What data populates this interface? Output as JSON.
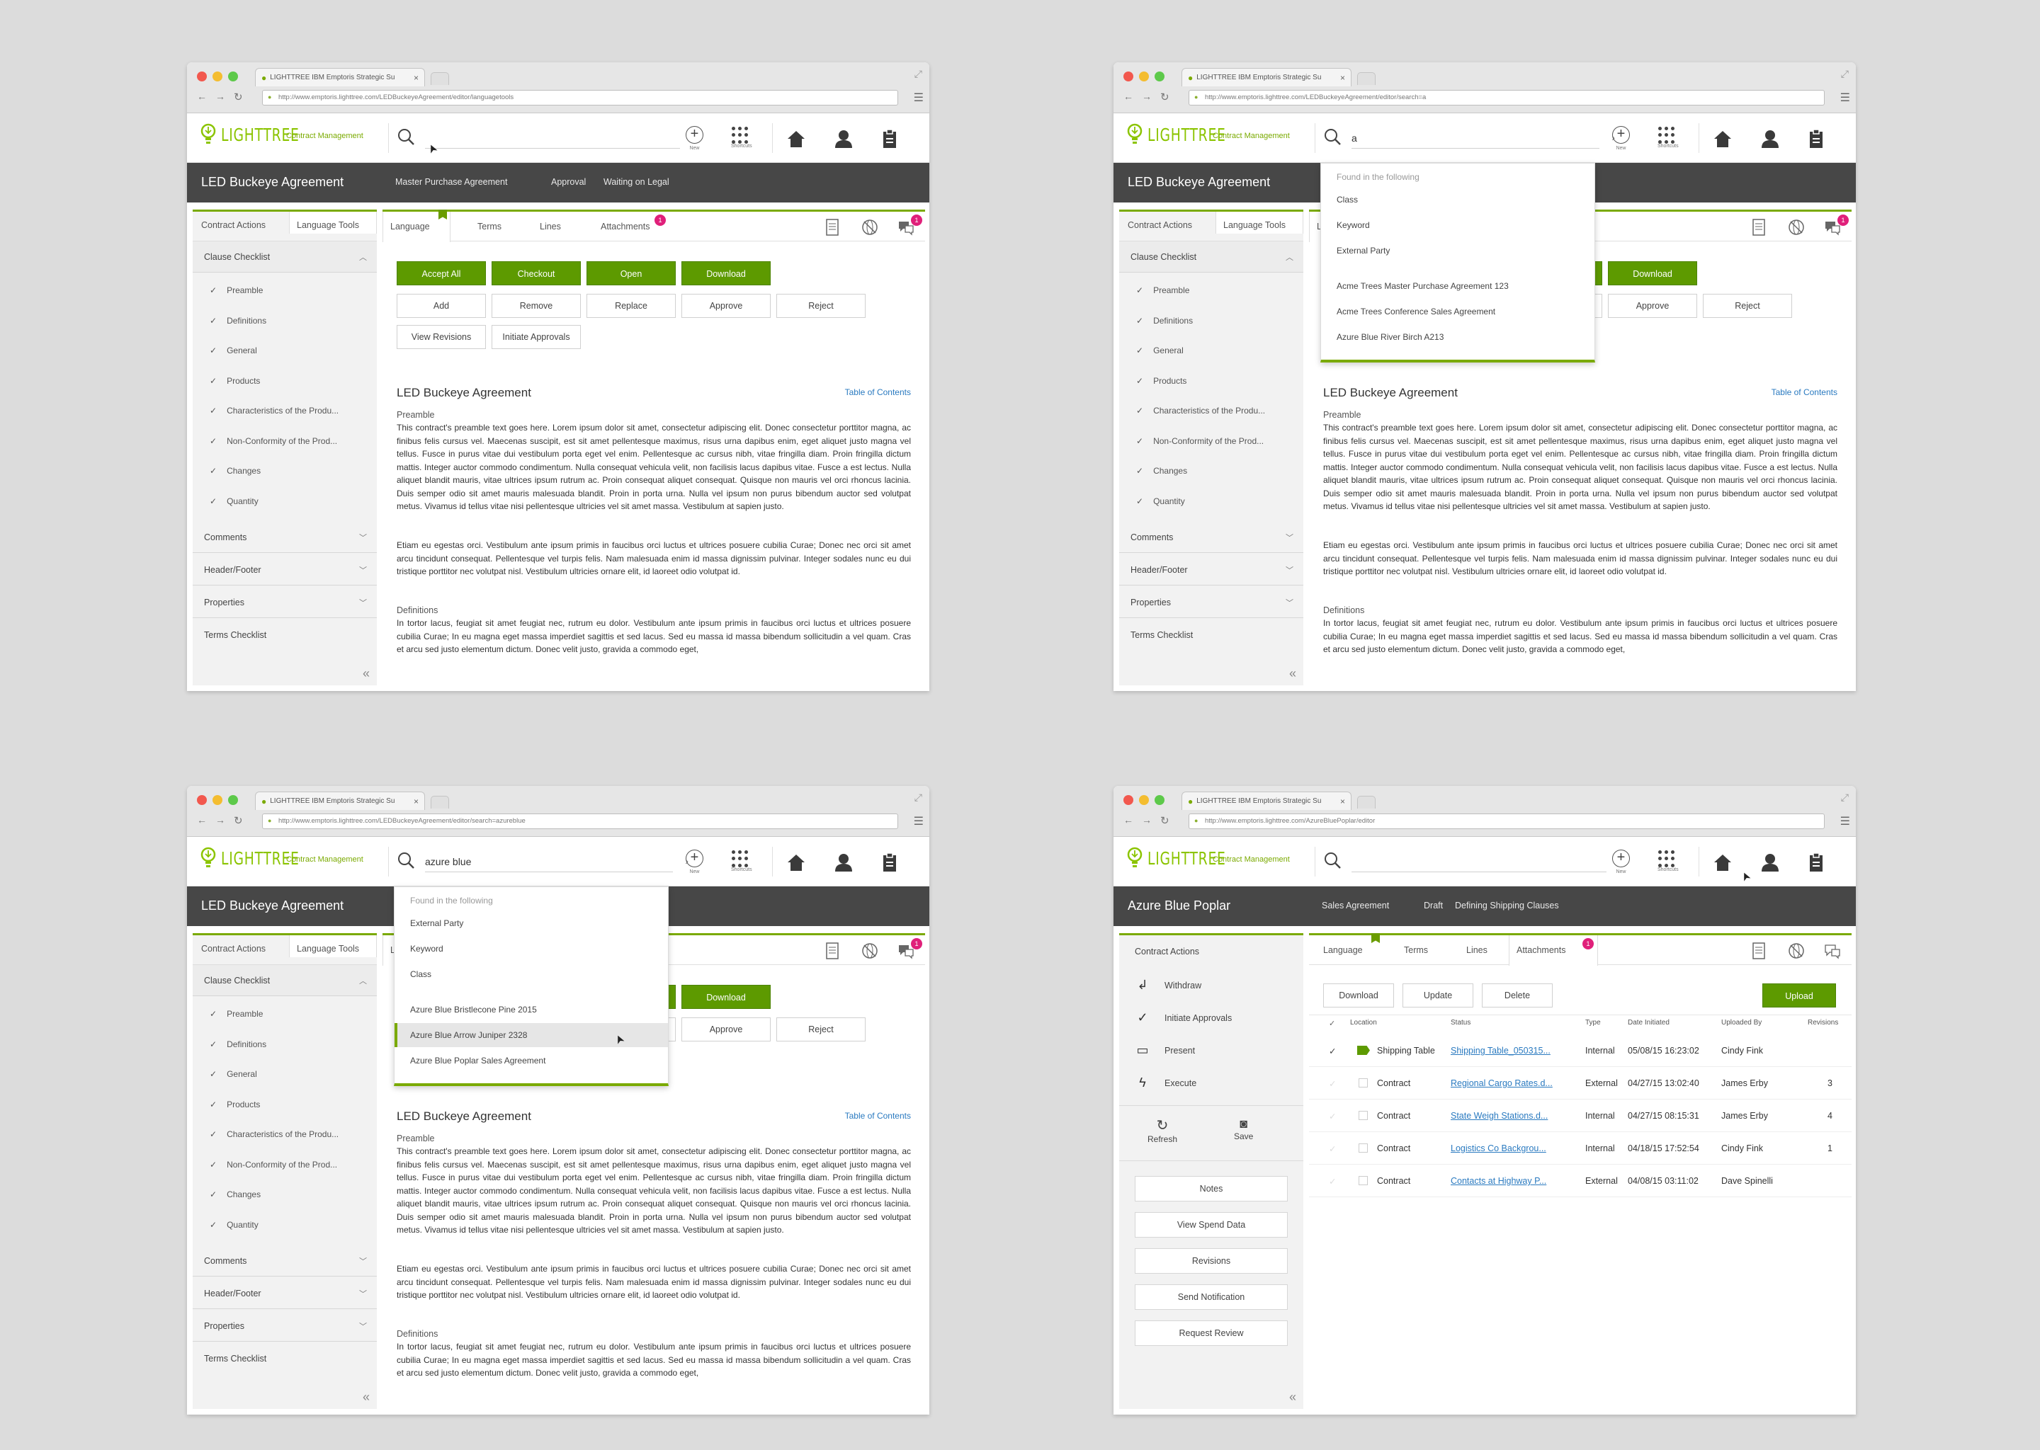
{
  "browser": {
    "tab_title": "LIGHTTREE IBM Emptoris Strategic Su",
    "urls": [
      "http://www.emptoris.lighttree.com/LEDBuckeyeAgreement/editor/languagetools",
      "http://www.emptoris.lighttree.com/LEDBuckeyeAgreement/editor/search=a",
      "http://www.emptoris.lighttree.com/LEDBuckeyeAgreement/editor/search=azureblue",
      "http://www.emptoris.lighttree.com/AzureBluePoplar/editor"
    ]
  },
  "app": {
    "brand": "LIGHTTREE",
    "module": "Contract Management",
    "new_label": "New",
    "shortcuts_label": "Shortcuts",
    "colors": {
      "accent": "#7aaa00",
      "dark_bar": "#474747",
      "button_green": "#5d9a00",
      "link": "#2a7ac0",
      "badge": "#e0207a"
    }
  },
  "search": {
    "p2_query": "a",
    "p3_query": "azure blue"
  },
  "agreement": {
    "title": "LED Buckeye Agreement",
    "type": "Master Purchase Agreement",
    "stage": "Approval",
    "status": "Waiting on Legal"
  },
  "left_tabs": {
    "actions": "Contract Actions",
    "tools": "Language Tools"
  },
  "clause_checklist": {
    "title": "Clause Checklist",
    "items": [
      "Preamble",
      "Definitions",
      "General",
      "Products",
      "Characteristics of the Produ...",
      "Non-Conformity of the Prod...",
      "Changes",
      "Quantity"
    ]
  },
  "left_sections": [
    "Comments",
    "Header/Footer",
    "Properties",
    "Terms Checklist"
  ],
  "main_tabs": [
    "Language",
    "Terms",
    "Lines",
    "Attachments"
  ],
  "attach_badge": "1",
  "buttons": {
    "green": [
      "Accept All",
      "Checkout",
      "Open",
      "Download"
    ],
    "row2": [
      "Add",
      "Remove",
      "Replace",
      "Approve",
      "Reject"
    ],
    "row3": [
      "View Revisions",
      "Initiate Approvals"
    ]
  },
  "doc": {
    "toc": "Table of Contents",
    "preamble_h": "Preamble",
    "preamble": "This contract's preamble text goes here. Lorem ipsum dolor sit amet, consectetur adipiscing elit. Donec consectetur porttitor magna, ac finibus felis cursus vel. Maecenas suscipit, est sit amet pellentesque maximus, risus urna dapibus enim, eget aliquet justo magna vel tellus. Fusce in purus vitae dui vestibulum porta eget vel enim. Pellentesque ac cursus nibh, vitae fringilla diam. Proin fringilla dictum mattis. Integer auctor commodo condimentum. Nulla consequat vehicula velit, non facilisis lacus dapibus vitae. Fusce a est lectus. Nulla aliquet blandit mauris, vitae ultrices ipsum rutrum ac. Proin consequat aliquet consequat. Quisque non mauris vel orci rhoncus lacinia. Duis semper odio sit amet mauris malesuada blandit. Proin in porta urna. Nulla vel ipsum non purus bibendum auctor sed volutpat metus. Vivamus id tellus vitae nisi pellentesque ultricies vel sit amet massa. Vestibulum at sapien justo.",
    "para2": "Etiam eu egestas orci. Vestibulum ante ipsum primis in faucibus orci luctus et ultrices posuere cubilia Curae; Donec nec orci sit amet arcu tincidunt consequat. Pellentesque vel turpis felis. Nam malesuada enim id massa dignissim pulvinar. Integer sodales nunc eu dui tristique porttitor nec volutpat nisl. Vestibulum ultricies ornare elit, id laoreet odio volutpat id.",
    "definitions_h": "Definitions",
    "definitions": "In tortor lacus, feugiat sit amet feugiat nec, rutrum eu dolor. Vestibulum ante ipsum primis in faucibus orci luctus et ultrices posuere cubilia Curae; In eu magna eget massa imperdiet sagittis et sed lacus. Sed eu massa id massa bibendum sollicitudin a vel quam. Cras et arcu sed justo elementum dictum. Donec velit justo, gravida a commodo eget,"
  },
  "dropdown_a": {
    "header": "Found in the following",
    "cats": [
      "Class",
      "Keyword",
      "External Party"
    ],
    "results": [
      "Acme Trees Master Purchase Agreement 123",
      "Acme Trees Conference Sales Agreement",
      "Azure Blue River Birch A213"
    ]
  },
  "dropdown_b": {
    "header": "Found in the following",
    "cats": [
      "External Party",
      "Keyword",
      "Class"
    ],
    "results": [
      "Azure Blue Bristlecone Pine 2015",
      "Azure Blue Arrow Juniper 2328",
      "Azure Blue Poplar Sales Agreement"
    ]
  },
  "poplar": {
    "title": "Azure Blue Poplar",
    "type": "Sales Agreement",
    "stage": "Draft",
    "status": "Defining Shipping Clauses",
    "left_title": "Contract Actions",
    "actions": [
      "Withdraw",
      "Initiate Approvals",
      "Present",
      "Execute"
    ],
    "refresh": "Refresh",
    "save": "Save",
    "side_buttons": [
      "Notes",
      "View Spend Data",
      "Revisions",
      "Send Notification",
      "Request Review"
    ],
    "tab_buttons": [
      "Download",
      "Update",
      "Delete"
    ],
    "upload": "Upload",
    "columns": [
      "Location",
      "Status",
      "Type",
      "Date Initiated",
      "Uploaded By",
      "Revisions"
    ],
    "rows": [
      {
        "location": "Shipping Table",
        "status": "Shipping Table_050315...",
        "type": "Internal",
        "date": "05/08/15 16:23:02",
        "by": "Cindy Fink",
        "rev": ""
      },
      {
        "location": "Contract",
        "status": "Regional Cargo Rates.d...",
        "type": "External",
        "date": "04/27/15 13:02:40",
        "by": "James Erby",
        "rev": "3"
      },
      {
        "location": "Contract",
        "status": "State Weigh Stations.d...",
        "type": "Internal",
        "date": "04/27/15 08:15:31",
        "by": "James Erby",
        "rev": "4"
      },
      {
        "location": "Contract",
        "status": "Logistics Co Backgrou...",
        "type": "Internal",
        "date": "04/18/15 17:52:54",
        "by": "Cindy Fink",
        "rev": "1"
      },
      {
        "location": "Contract",
        "status": "Contacts at Highway P...",
        "type": "External",
        "date": "04/08/15 03:11:02",
        "by": "Dave Spinelli",
        "rev": ""
      }
    ]
  }
}
